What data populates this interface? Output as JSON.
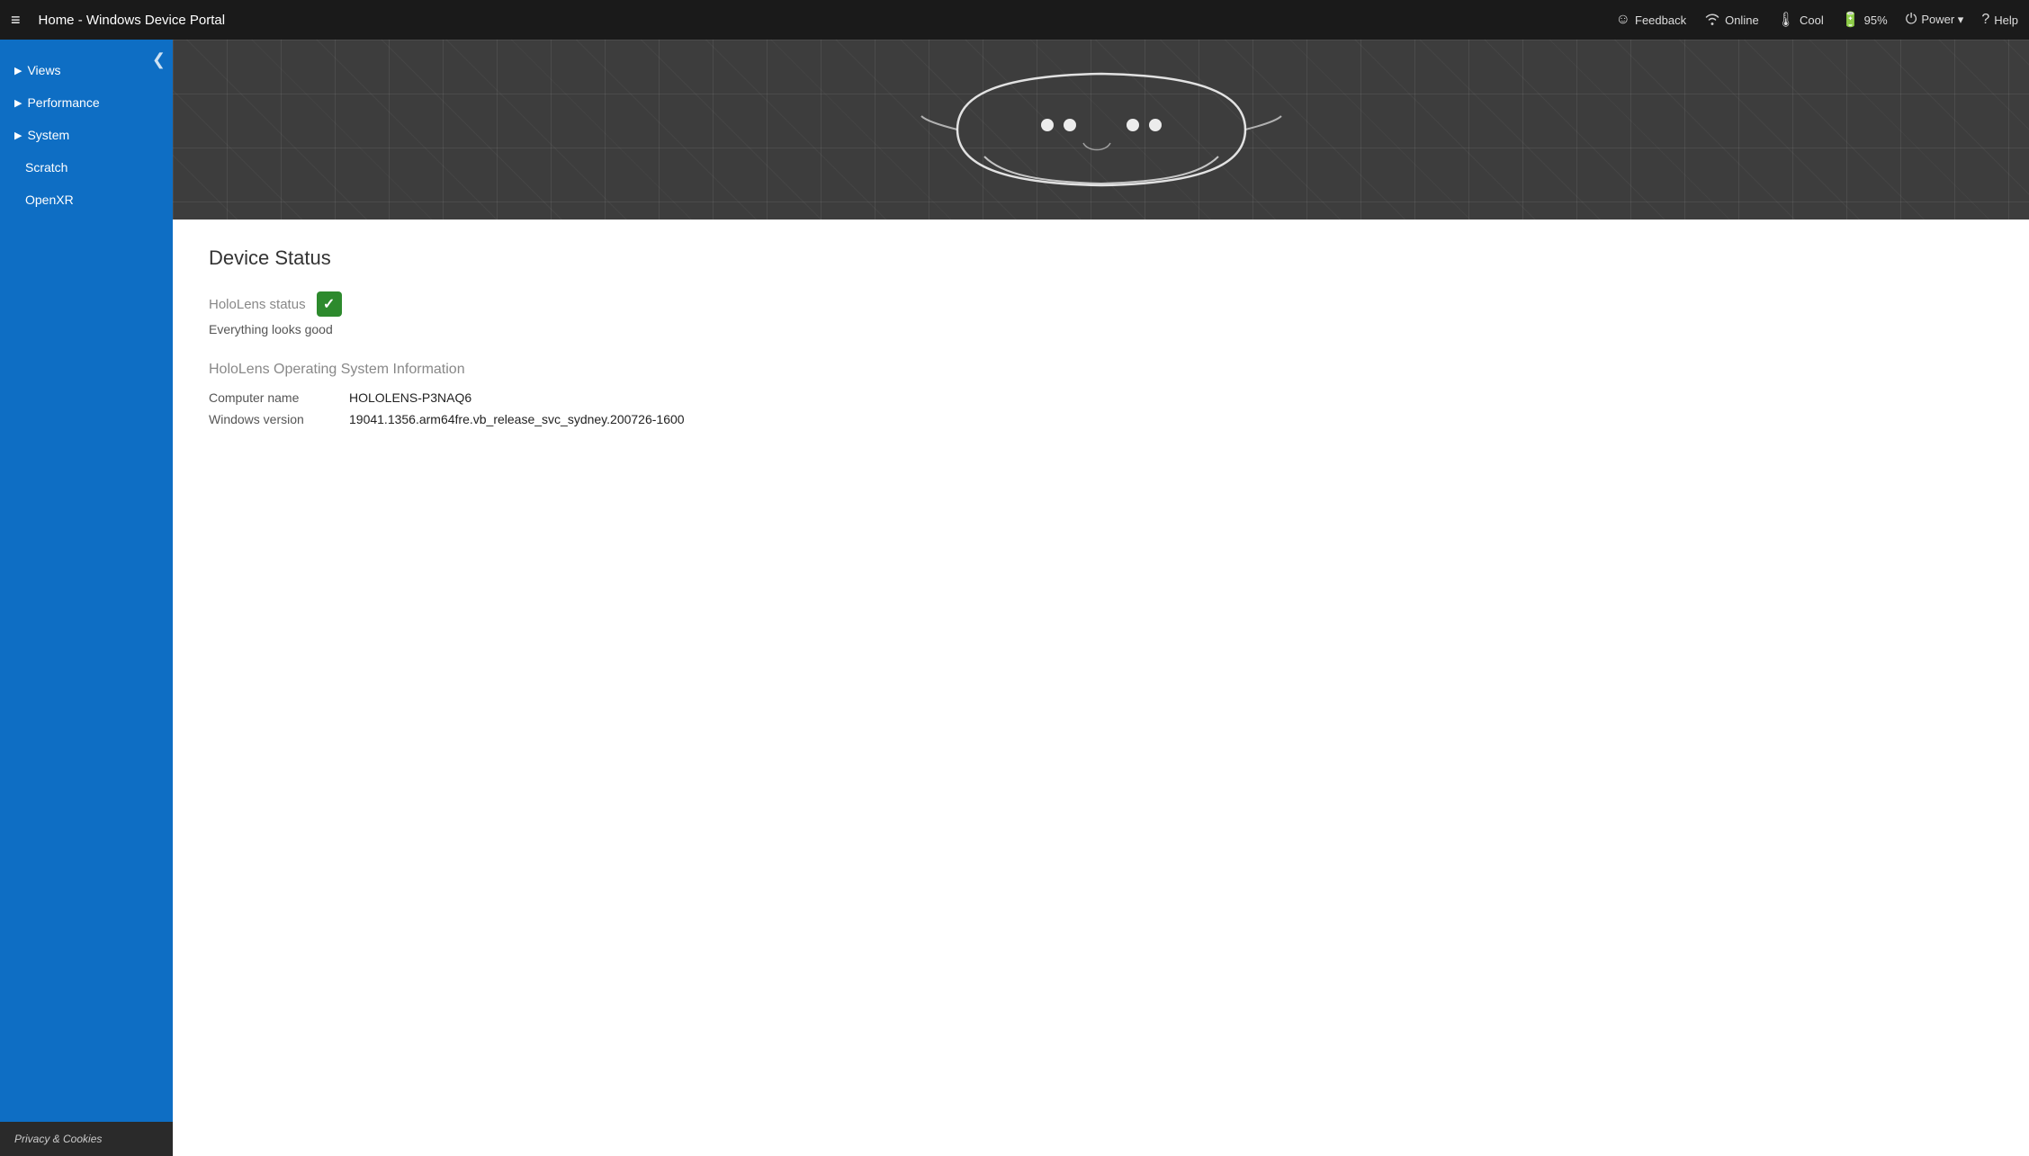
{
  "topbar": {
    "menu_icon": "≡",
    "title": "Home - Windows Device Portal",
    "actions": [
      {
        "id": "feedback",
        "icon": "☺",
        "label": "Feedback"
      },
      {
        "id": "online",
        "icon": "📶",
        "label": "Online"
      },
      {
        "id": "cool",
        "icon": "🌡",
        "label": "Cool"
      },
      {
        "id": "battery",
        "icon": "🔋",
        "label": "95%"
      },
      {
        "id": "power",
        "icon": "⏻",
        "label": "Power ▾"
      },
      {
        "id": "help",
        "icon": "?",
        "label": "Help"
      }
    ]
  },
  "sidebar": {
    "collapse_icon": "❮",
    "items": [
      {
        "id": "views",
        "label": "Views",
        "arrow": "▶",
        "sub": false
      },
      {
        "id": "performance",
        "label": "Performance",
        "arrow": "▶",
        "sub": false
      },
      {
        "id": "system",
        "label": "System",
        "arrow": "▶",
        "sub": false
      },
      {
        "id": "scratch",
        "label": "Scratch",
        "arrow": "",
        "sub": true
      },
      {
        "id": "openxr",
        "label": "OpenXR",
        "arrow": "",
        "sub": true
      }
    ],
    "footer": "Privacy & Cookies"
  },
  "main": {
    "device_status": {
      "section_title": "Device Status",
      "hololens_status_label": "HoloLens status",
      "status_check": "✓",
      "status_message": "Everything looks good",
      "os_section_title": "HoloLens Operating System Information",
      "fields": [
        {
          "key": "Computer name",
          "value": "HOLOLENS-P3NAQ6"
        },
        {
          "key": "Windows version",
          "value": "19041.1356.arm64fre.vb_release_svc_sydney.200726-1600"
        }
      ]
    }
  }
}
